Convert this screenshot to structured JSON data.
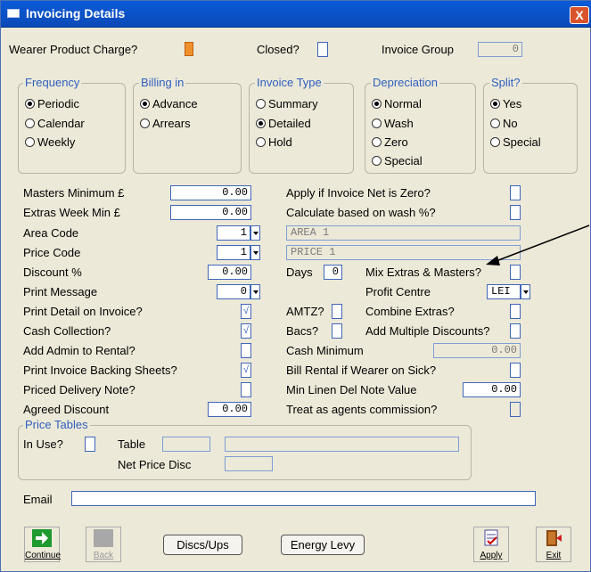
{
  "window": {
    "title": "Invoicing Details",
    "close_label": "X"
  },
  "top": {
    "wearer_product_charge_label": "Wearer Product Charge?",
    "closed_label": "Closed?",
    "invoice_group_label": "Invoice Group",
    "invoice_group_value": "0"
  },
  "frequency": {
    "title": "Frequency",
    "options": [
      "Periodic",
      "Calendar",
      "Weekly"
    ],
    "selected": "Periodic"
  },
  "billing": {
    "title": "Billing in",
    "options": [
      "Advance",
      "Arrears"
    ],
    "selected": "Advance"
  },
  "invoice_type": {
    "title": "Invoice Type",
    "options": [
      "Summary",
      "Detailed",
      "Hold"
    ],
    "selected": "Detailed"
  },
  "depreciation": {
    "title": "Depreciation",
    "options": [
      "Normal",
      "Wash",
      "Zero",
      "Special"
    ],
    "selected": "Normal"
  },
  "split": {
    "title": "Split?",
    "options": [
      "Yes",
      "No",
      "Special"
    ],
    "selected": "Yes"
  },
  "left": {
    "masters_min_label": "Masters Minimum £",
    "masters_min_value": "0.00",
    "extras_week_min_label": "Extras Week Min £",
    "extras_week_min_value": "0.00",
    "area_code_label": "Area Code",
    "area_code_value": "1",
    "price_code_label": "Price Code",
    "price_code_value": "1",
    "discount_label": "Discount %",
    "discount_value": "0.00",
    "print_message_label": "Print Message",
    "print_message_value": "0",
    "print_detail_label": "Print Detail on Invoice?",
    "cash_collection_label": "Cash Collection?",
    "add_admin_label": "Add Admin to Rental?",
    "print_backing_label": "Print Invoice Backing Sheets?",
    "priced_delivery_label": "Priced Delivery Note?",
    "agreed_discount_label": "Agreed Discount",
    "agreed_discount_value": "0.00",
    "check_mark": "√"
  },
  "right": {
    "apply_if_zero_label": "Apply if Invoice Net is Zero?",
    "calc_wash_label": "Calculate based on wash %?",
    "area_name": "AREA 1",
    "price_name": "PRICE 1",
    "days_label": "Days",
    "days_value": "0",
    "mix_extras_label": "Mix Extras & Masters?",
    "profit_centre_label": "Profit Centre",
    "profit_centre_value": "LEI",
    "amtz_label": "AMTZ?",
    "combine_extras_label": "Combine Extras?",
    "bacs_label": "Bacs?",
    "add_multi_disc_label": "Add Multiple Discounts?",
    "cash_min_label": "Cash Minimum",
    "cash_min_value": "0.00",
    "bill_rental_sick_label": "Bill Rental if Wearer on Sick?",
    "min_linen_label": "Min Linen Del Note Value",
    "min_linen_value": "0.00",
    "treat_agents_label": "Treat as agents commission?"
  },
  "price_tables": {
    "title": "Price Tables",
    "in_use_label": "In Use?",
    "table_label": "Table",
    "net_price_disc_label": "Net Price Disc"
  },
  "email": {
    "label": "Email",
    "value": ""
  },
  "buttons": {
    "continue": "Continue",
    "back": "Back",
    "discs_ups": "Discs/Ups",
    "energy_levy": "Energy Levy",
    "apply": "Apply",
    "exit": "Exit"
  }
}
